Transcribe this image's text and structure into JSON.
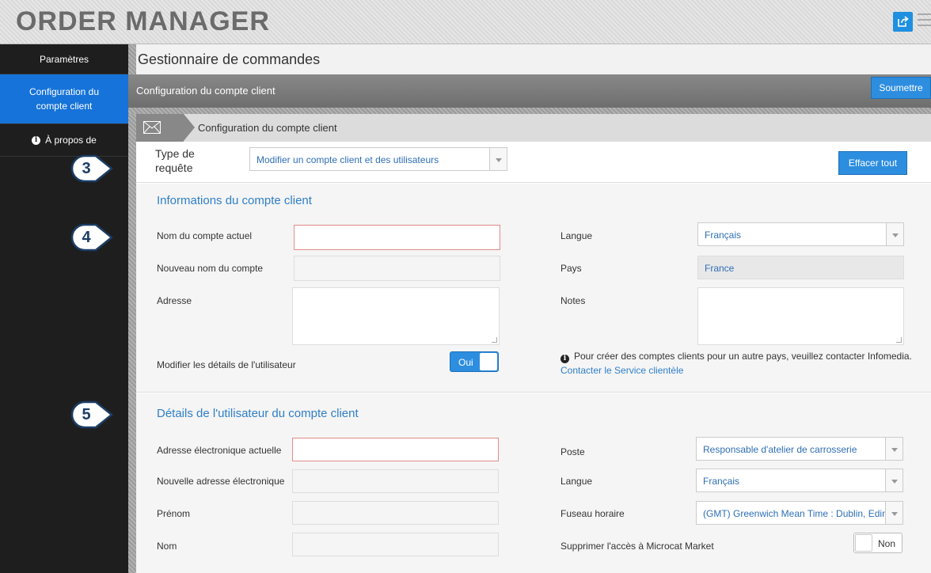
{
  "app": {
    "title": "ORDER MANAGER"
  },
  "sidebar": {
    "items": [
      {
        "label": "Paramètres"
      },
      {
        "label": "Configuration du compte client"
      },
      {
        "label": "À propos de"
      }
    ]
  },
  "page": {
    "title": "Gestionnaire de commandes"
  },
  "section": {
    "title": "Configuration du compte client",
    "submit_label": "Soumettre"
  },
  "breadcrumb": {
    "label": "Configuration du compte client"
  },
  "request": {
    "label": "Type de requête",
    "selected": "Modifier un compte client et des utilisateurs",
    "clear_label": "Effacer tout"
  },
  "account_info": {
    "title": "Informations du compte client",
    "current_name_label": "Nom du compte actuel",
    "new_name_label": "Nouveau nom du compte",
    "address_label": "Adresse",
    "edit_user_label": "Modifier les détails de l'utilisateur",
    "edit_user_toggle": "Oui",
    "language_label": "Langue",
    "language_value": "Français",
    "country_label": "Pays",
    "country_value": "France",
    "notes_label": "Notes",
    "info_text": "Pour créer des comptes clients pour un autre pays, veuillez contacter Infomedia.",
    "contact_link": "Contacter le Service clientèle"
  },
  "user_details": {
    "title": "Détails de l'utilisateur du compte client",
    "current_email_label": "Adresse électronique actuelle",
    "new_email_label": "Nouvelle adresse électronique",
    "first_name_label": "Prénom",
    "last_name_label": "Nom",
    "position_label": "Poste",
    "position_value": "Responsable d'atelier de carrosserie",
    "language_label": "Langue",
    "language_value": "Français",
    "timezone_label": "Fuseau horaire",
    "timezone_value": "(GMT) Greenwich Mean Time : Dublin, Edin",
    "remove_access_label": "Supprimer l'accès à Microcat Market",
    "remove_access_toggle": "Non"
  },
  "callouts": [
    "3",
    "4",
    "5"
  ],
  "colors": {
    "accent": "#1673d9",
    "button": "#2d8ee0",
    "link": "#2f7fc8",
    "required_border": "#e58b8b"
  }
}
